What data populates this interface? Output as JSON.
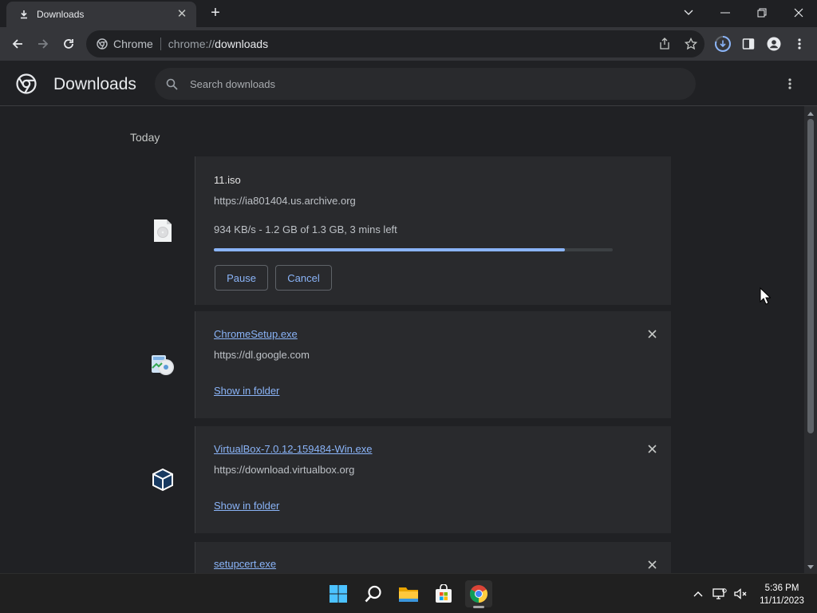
{
  "tab": {
    "title": "Downloads",
    "icon": "download-icon"
  },
  "window_controls": [
    "chevron-down-icon",
    "minimize-icon",
    "restore-icon",
    "close-icon"
  ],
  "omnibox": {
    "site_name": "Chrome",
    "url_scheme": "chrome://",
    "url_host": "downloads"
  },
  "page": {
    "title": "Downloads",
    "search_placeholder": "Search downloads",
    "section": "Today"
  },
  "downloads": [
    {
      "file_name": "11.iso",
      "url": "https://ia801404.us.archive.org",
      "status": "934 KB/s - 1.2 GB of 1.3 GB, 3 mins left",
      "progress": 0.88,
      "pause_label": "Pause",
      "cancel_label": "Cancel"
    },
    {
      "file_name": "ChromeSetup.exe",
      "url": "https://dl.google.com",
      "action_label": "Show in folder"
    },
    {
      "file_name": "VirtualBox-7.0.12-159484-Win.exe",
      "url": "https://download.virtualbox.org",
      "action_label": "Show in folder"
    },
    {
      "file_name": "setupcert.exe"
    }
  ],
  "taskbar": {
    "apps": [
      "windows-start-icon",
      "search-icon",
      "file-explorer-icon",
      "microsoft-store-icon",
      "chrome-icon"
    ],
    "time": "5:36 PM",
    "date": "11/11/2023"
  },
  "colors": {
    "accent": "#8ab4f8",
    "background": "#202124",
    "card": "#292a2d"
  }
}
